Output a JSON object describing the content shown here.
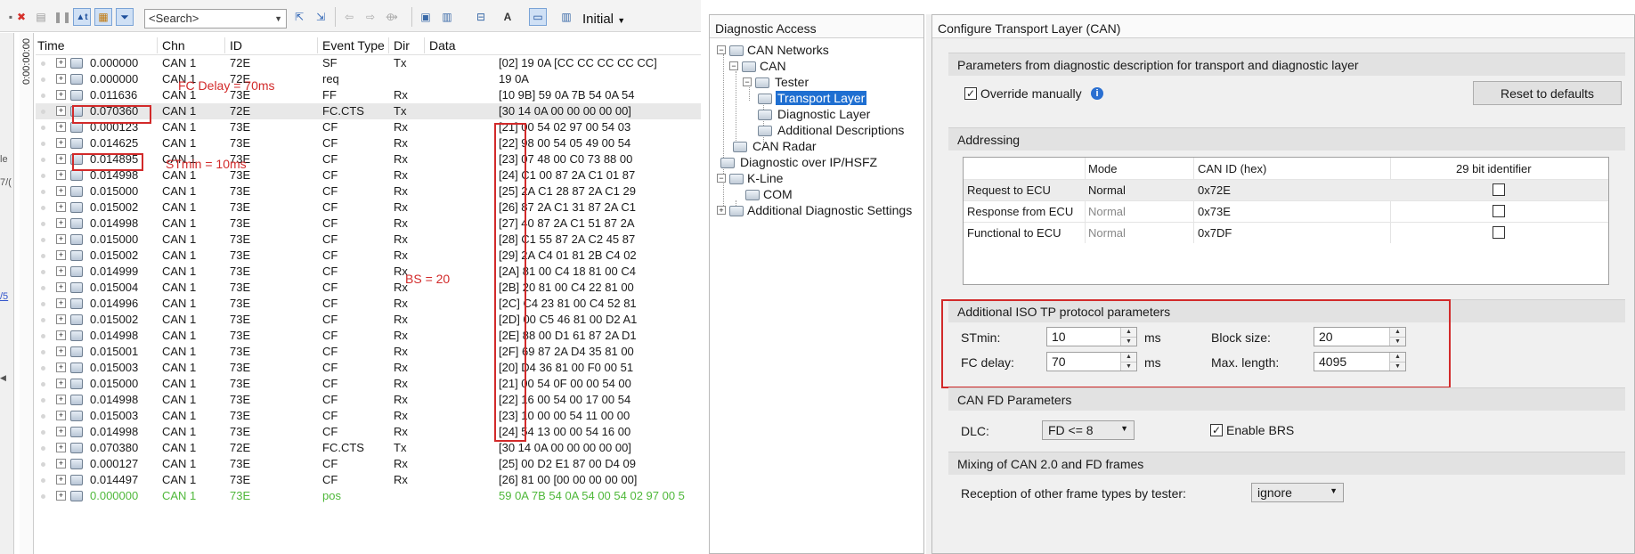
{
  "toolbar": {
    "search_placeholder": "<Search>",
    "layout_label": "Initial",
    "icons": [
      "stop-icon",
      "delete-icon",
      "pause-icon",
      "autoscroll-icon",
      "filter-icon",
      "funnel-icon",
      "find-prev-icon",
      "find-next-icon",
      "back-icon",
      "forward-icon",
      "connect-icon",
      "window-icon",
      "window-menu-icon",
      "column-icon",
      "font-icon",
      "view-icon",
      "layout-icon"
    ]
  },
  "left_strip": [
    "le",
    "7/(",
    "/5"
  ],
  "time_ruler": "0:00:00:00",
  "trace": {
    "columns": [
      "Time",
      "Chn",
      "ID",
      "Event Type",
      "Dir",
      "Data"
    ],
    "rows": [
      {
        "time": "0.000000",
        "chn": "CAN 1",
        "id": "72E",
        "event": "SF",
        "dir": "Tx",
        "data": "[02] 19 0A [CC CC CC CC CC]"
      },
      {
        "time": "0.000000",
        "chn": "CAN 1",
        "id": "72E",
        "event": "req",
        "dir": "",
        "data": "19 0A"
      },
      {
        "time": "0.011636",
        "chn": "CAN 1",
        "id": "73E",
        "event": "FF",
        "dir": "Rx",
        "data": "[10 9B] 59 0A 7B 54 0A 54"
      },
      {
        "time": "0.070360",
        "chn": "CAN 1",
        "id": "72E",
        "event": "FC.CTS",
        "dir": "Tx",
        "data": "[30 14 0A 00 00 00 00 00]"
      },
      {
        "time": "0.000123",
        "chn": "CAN 1",
        "id": "73E",
        "event": "CF",
        "dir": "Rx",
        "data": "[21] 00 54 02 97 00 54 03"
      },
      {
        "time": "0.014625",
        "chn": "CAN 1",
        "id": "73E",
        "event": "CF",
        "dir": "Rx",
        "data": "[22] 98 00 54 05 49 00 54"
      },
      {
        "time": "0.014895",
        "chn": "CAN 1",
        "id": "73E",
        "event": "CF",
        "dir": "Rx",
        "data": "[23] 07 48 00 C0 73 88 00"
      },
      {
        "time": "0.014998",
        "chn": "CAN 1",
        "id": "73E",
        "event": "CF",
        "dir": "Rx",
        "data": "[24] C1 00 87 2A C1 01 87"
      },
      {
        "time": "0.015000",
        "chn": "CAN 1",
        "id": "73E",
        "event": "CF",
        "dir": "Rx",
        "data": "[25] 2A C1 28 87 2A C1 29"
      },
      {
        "time": "0.015002",
        "chn": "CAN 1",
        "id": "73E",
        "event": "CF",
        "dir": "Rx",
        "data": "[26] 87 2A C1 31 87 2A C1"
      },
      {
        "time": "0.014998",
        "chn": "CAN 1",
        "id": "73E",
        "event": "CF",
        "dir": "Rx",
        "data": "[27] 40 87 2A C1 51 87 2A"
      },
      {
        "time": "0.015000",
        "chn": "CAN 1",
        "id": "73E",
        "event": "CF",
        "dir": "Rx",
        "data": "[28] C1 55 87 2A C2 45 87"
      },
      {
        "time": "0.015002",
        "chn": "CAN 1",
        "id": "73E",
        "event": "CF",
        "dir": "Rx",
        "data": "[29] 2A C4 01 81 2B C4 02"
      },
      {
        "time": "0.014999",
        "chn": "CAN 1",
        "id": "73E",
        "event": "CF",
        "dir": "Rx",
        "data": "[2A] 81 00 C4 18 81 00 C4"
      },
      {
        "time": "0.015004",
        "chn": "CAN 1",
        "id": "73E",
        "event": "CF",
        "dir": "Rx",
        "data": "[2B] 20 81 00 C4 22 81 00"
      },
      {
        "time": "0.014996",
        "chn": "CAN 1",
        "id": "73E",
        "event": "CF",
        "dir": "Rx",
        "data": "[2C] C4 23 81 00 C4 52 81"
      },
      {
        "time": "0.015002",
        "chn": "CAN 1",
        "id": "73E",
        "event": "CF",
        "dir": "Rx",
        "data": "[2D] 00 C5 46 81 00 D2 A1"
      },
      {
        "time": "0.014998",
        "chn": "CAN 1",
        "id": "73E",
        "event": "CF",
        "dir": "Rx",
        "data": "[2E] 88 00 D1 61 87 2A D1"
      },
      {
        "time": "0.015001",
        "chn": "CAN 1",
        "id": "73E",
        "event": "CF",
        "dir": "Rx",
        "data": "[2F] 69 87 2A D4 35 81 00"
      },
      {
        "time": "0.015003",
        "chn": "CAN 1",
        "id": "73E",
        "event": "CF",
        "dir": "Rx",
        "data": "[20] D4 36 81 00 F0 00 51"
      },
      {
        "time": "0.015000",
        "chn": "CAN 1",
        "id": "73E",
        "event": "CF",
        "dir": "Rx",
        "data": "[21] 00 54 0F 00 00 54 00"
      },
      {
        "time": "0.014998",
        "chn": "CAN 1",
        "id": "73E",
        "event": "CF",
        "dir": "Rx",
        "data": "[22] 16 00 54 00 17 00 54"
      },
      {
        "time": "0.015003",
        "chn": "CAN 1",
        "id": "73E",
        "event": "CF",
        "dir": "Rx",
        "data": "[23] 10 00 00 54 11 00 00"
      },
      {
        "time": "0.014998",
        "chn": "CAN 1",
        "id": "73E",
        "event": "CF",
        "dir": "Rx",
        "data": "[24] 54 13 00 00 54 16 00"
      },
      {
        "time": "0.070380",
        "chn": "CAN 1",
        "id": "72E",
        "event": "FC.CTS",
        "dir": "Tx",
        "data": "[30 14 0A 00 00 00 00 00]"
      },
      {
        "time": "0.000127",
        "chn": "CAN 1",
        "id": "73E",
        "event": "CF",
        "dir": "Rx",
        "data": "[25] 00 D2 E1 87 00 D4 09"
      },
      {
        "time": "0.014497",
        "chn": "CAN 1",
        "id": "73E",
        "event": "CF",
        "dir": "Rx",
        "data": "[26] 81 00 [00 00 00 00 00]"
      },
      {
        "time": "0.000000",
        "chn": "CAN 1",
        "id": "73E",
        "event": "pos",
        "dir": "",
        "data": "59 0A 7B 54 0A 54 00 54 02 97 00 5"
      }
    ]
  },
  "annotations": {
    "fc_delay": "FC Delay = 70ms",
    "stmin": "STmin = 10ms",
    "bs": "BS = 20"
  },
  "diag_access": {
    "title": "Diagnostic Access",
    "tree": [
      "CAN Networks",
      "CAN",
      "Tester",
      "Transport Layer",
      "Diagnostic Layer",
      "Additional Descriptions",
      "CAN Radar",
      "Diagnostic over IP/HSFZ",
      "K-Line",
      "COM",
      "Additional Diagnostic Settings"
    ]
  },
  "transport": {
    "title": "Configure Transport Layer (CAN)",
    "params_section": "Parameters from diagnostic description for transport and diagnostic layer",
    "override_label": "Override manually",
    "override_checked": true,
    "reset_button": "Reset to defaults",
    "addressing_section": "Addressing",
    "addr_headers": [
      "Mode",
      "CAN ID (hex)",
      "29 bit identifier"
    ],
    "addr_rows": [
      {
        "name": "Request to ECU",
        "mode": "Normal",
        "canid": "0x72E"
      },
      {
        "name": "Response from ECU",
        "mode": "Normal",
        "canid": "0x73E"
      },
      {
        "name": "Functional to ECU",
        "mode": "Normal",
        "canid": "0x7DF"
      }
    ],
    "iso_section": "Additional ISO TP protocol parameters",
    "stmin_label": "STmin:",
    "stmin_value": "10",
    "fcdelay_label": "FC delay:",
    "fcdelay_value": "70",
    "unit_ms": "ms",
    "blocksize_label": "Block size:",
    "blocksize_value": "20",
    "maxlen_label": "Max. length:",
    "maxlen_value": "4095",
    "canfd_section": "CAN FD Parameters",
    "dlc_label": "DLC:",
    "dlc_value": "FD <= 8",
    "enable_brs_label": "Enable BRS",
    "enable_brs_checked": true,
    "mixing_section": "Mixing of CAN 2.0 and FD frames",
    "reception_label": "Reception of other frame types by tester:",
    "reception_value": "ignore"
  },
  "colors": {
    "annotation": "#d22a2a",
    "selection": "#1f6fd1",
    "pos_row": "#4fb83a"
  }
}
